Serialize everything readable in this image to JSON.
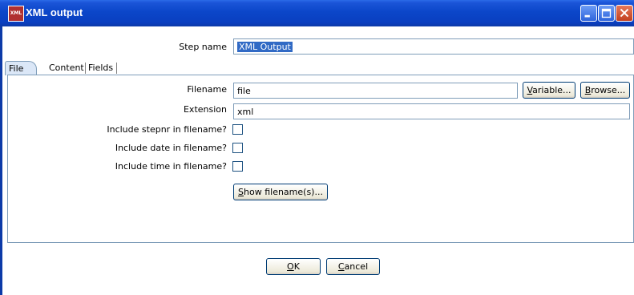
{
  "window": {
    "title": "XML output",
    "app_icon_text": "XML",
    "controls": {
      "minimize": "minimize",
      "maximize": "maximize",
      "close": "close"
    }
  },
  "step": {
    "label": "Step name",
    "value": "XML Output"
  },
  "tabs": [
    {
      "label": "File",
      "active": true
    },
    {
      "label": "Content",
      "active": false
    },
    {
      "label": "Fields",
      "active": false
    }
  ],
  "file": {
    "filename_label": "Filename",
    "filename_value": "file",
    "variable_button": {
      "mnemonic": "V",
      "rest": "ariable..."
    },
    "browse_button": {
      "mnemonic": "B",
      "rest": "rowse..."
    },
    "extension_label": "Extension",
    "extension_value": "xml",
    "include_stepnr_label": "Include stepnr in filename?",
    "include_date_label": "Include date in filename?",
    "include_time_label": "Include time in filename?",
    "include_stepnr": false,
    "include_date": false,
    "include_time": false,
    "show_button": {
      "mnemonic": "S",
      "rest": "how filename(s)..."
    }
  },
  "footer": {
    "ok_button": {
      "mnemonic": "O",
      "rest": "K"
    },
    "cancel_button": {
      "mnemonic": "C",
      "rest": "ancel"
    }
  }
}
